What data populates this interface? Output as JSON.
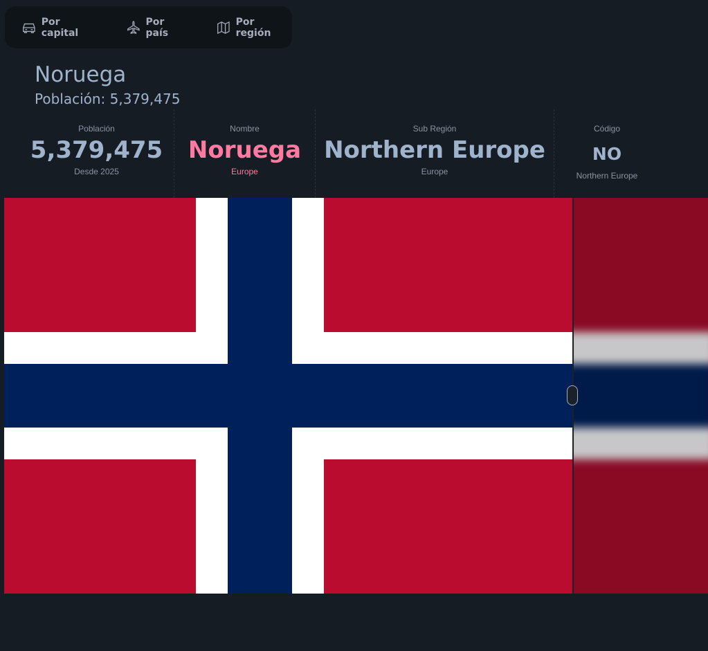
{
  "tabs": [
    {
      "label": "Por capital",
      "icon": "car-icon"
    },
    {
      "label": "Por país",
      "icon": "airplane-icon"
    },
    {
      "label": "Por región",
      "icon": "map-icon"
    }
  ],
  "country": {
    "name": "Noruega",
    "population_line": "Población: 5,379,475"
  },
  "stats": [
    {
      "title": "Población",
      "value": "5,379,475",
      "desc": "Desde 2025"
    },
    {
      "title": "Nombre",
      "value": "Noruega",
      "desc": "Europe"
    },
    {
      "title": "Sub Región",
      "value": "Northern Europe",
      "desc": "Europe"
    },
    {
      "title": "Código",
      "value": "NO",
      "desc": "Northern Europe"
    }
  ],
  "colors": {
    "background": "#161c23",
    "accent_pink": "#ff7aa0",
    "flag_red": "#ba0c2f",
    "flag_white": "#ffffff",
    "flag_blue": "#00205b"
  }
}
